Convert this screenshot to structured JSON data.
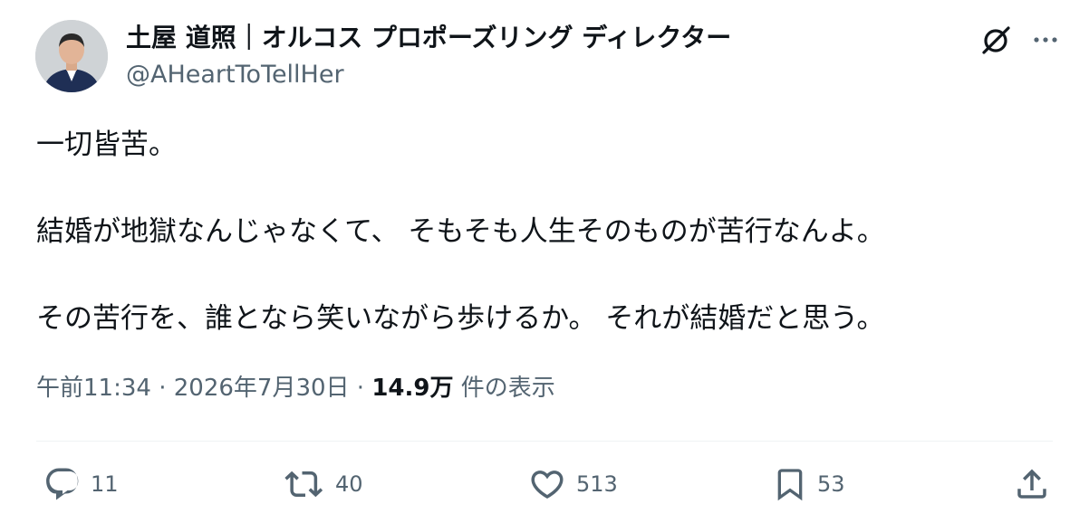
{
  "author": {
    "display_name": "土屋 道照｜オルコス プロポーズリング ディレクター",
    "handle": "@AHeartToTellHer"
  },
  "tweet": {
    "lines": [
      "一切皆苦。",
      "結婚が地獄なんじゃなくて、 そもそも人生そのものが苦行なんよ。",
      "その苦行を、誰となら笑いながら歩けるか。 それが結婚だと思う。"
    ]
  },
  "meta": {
    "time": "午前11:34",
    "separator": "·",
    "date": "2026年7月30日",
    "views_count": "14.9万",
    "views_label": "件の表示"
  },
  "actions": {
    "replies": "11",
    "reposts": "40",
    "likes": "513",
    "bookmarks": "53"
  },
  "icons": {
    "header": [
      "grok-icon",
      "more-icon"
    ],
    "actions": [
      "reply-icon",
      "repost-icon",
      "like-icon",
      "bookmark-icon",
      "share-icon"
    ]
  },
  "colors": {
    "text": "#0f1419",
    "secondary": "#536471",
    "divider": "#eff3f4"
  }
}
